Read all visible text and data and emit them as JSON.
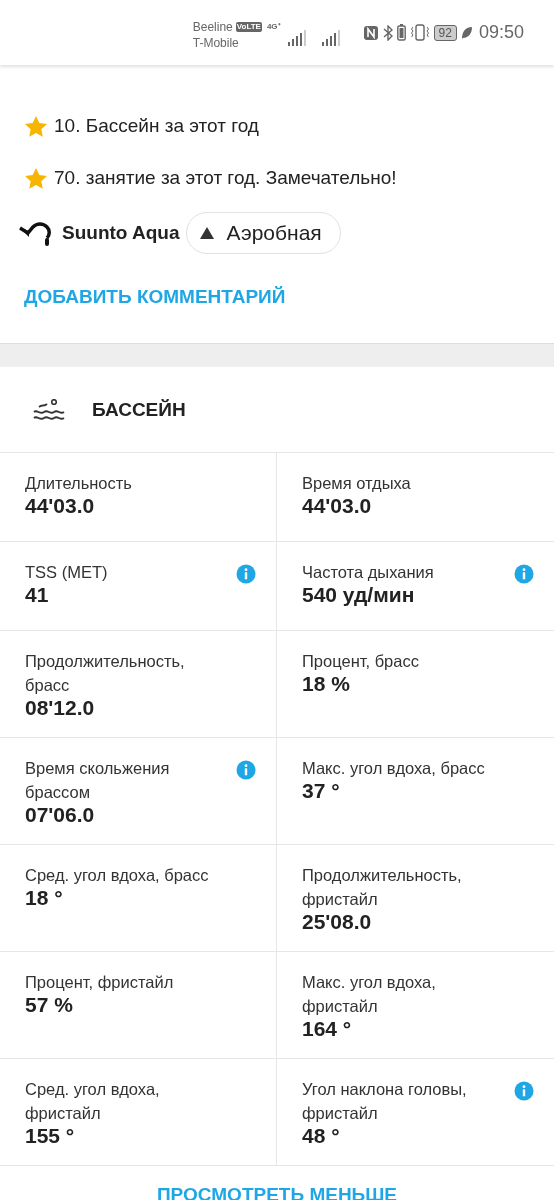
{
  "status_bar": {
    "carrier_1": "Beeline",
    "volte": "VoLTE",
    "network": "4G⁺",
    "carrier_2": "T-Mobile",
    "battery": "92",
    "time": "09:50"
  },
  "achievements": [
    {
      "text": "10. Бассейн за этот год"
    },
    {
      "text": "70. занятие за этот год. Замечательно!"
    }
  ],
  "device": {
    "name": "Suunto Aqua",
    "intensity": "Аэробная"
  },
  "add_comment": "ДОБАВИТЬ КОММЕНТАРИЙ",
  "section": {
    "title": "БАССЕЙН"
  },
  "stats": [
    {
      "label": "Длительность",
      "value": "44'03.0",
      "info": false
    },
    {
      "label": "Время отдыха",
      "value": "44'03.0",
      "info": false
    },
    {
      "label": "TSS (MET)",
      "value": "41",
      "info": true
    },
    {
      "label": "Частота дыхания",
      "value": "540 уд/мин",
      "info": true
    },
    {
      "label": "Продолжительность, брасс",
      "value": "08'12.0",
      "info": false
    },
    {
      "label": "Процент, брасс",
      "value": "18 %",
      "info": false
    },
    {
      "label": "Время скольжения брассом",
      "value": "07'06.0",
      "info": true
    },
    {
      "label": "Макс. угол вдоха, брасс",
      "value": "37 °",
      "info": false
    },
    {
      "label": "Сред. угол вдоха, брасс",
      "value": "18 °",
      "info": false
    },
    {
      "label": "Продолжительность, фристайл",
      "value": "25'08.0",
      "info": false
    },
    {
      "label": "Процент, фристайл",
      "value": "57 %",
      "info": false
    },
    {
      "label": "Макс. угол вдоха, фристайл",
      "value": "164 °",
      "info": false
    },
    {
      "label": "Сред. угол вдоха, фристайл",
      "value": "155 °",
      "info": false
    },
    {
      "label": "Угол наклона головы, фристайл",
      "value": "48 °",
      "info": true
    }
  ],
  "show_less": "ПРОСМОТРЕТЬ МЕНЬШЕ"
}
